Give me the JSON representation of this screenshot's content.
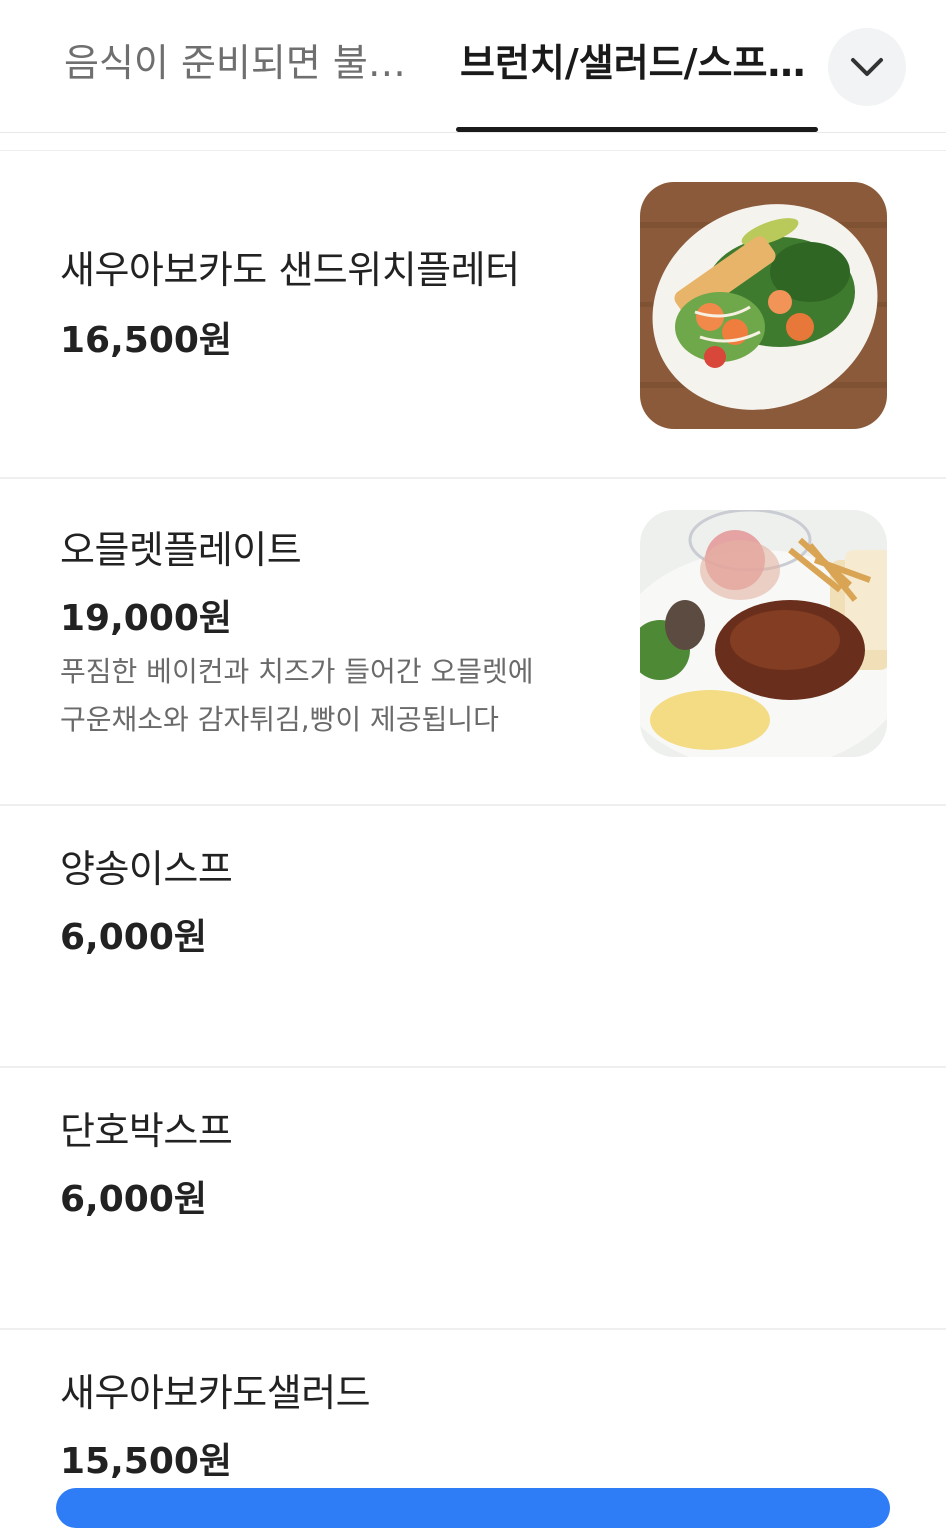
{
  "tabs": [
    {
      "label": "음식이 준비되면 불…",
      "active": false
    },
    {
      "label": "브런치/샐러드/스프…",
      "active": true
    }
  ],
  "dropdown_icon": "chevron-down-icon",
  "items": [
    {
      "name": "새우아보카도 샌드위치플레터",
      "price": "16,500원",
      "description": "",
      "image": "shrimp-avocado-sandwich-plate"
    },
    {
      "name": "오믈렛플레이트",
      "price": "19,000원",
      "description_lines": [
        "푸짐한 베이컨과 치즈가 들어간 오믈렛에",
        "구운채소와 감자튀김,빵이 제공됩니다"
      ],
      "image": "omelet-plate"
    },
    {
      "name": "양송이스프",
      "price": "6,000원"
    },
    {
      "name": "단호박스프",
      "price": "6,000원"
    },
    {
      "name": "새우아보카도샐러드",
      "price": "15,500원"
    }
  ],
  "colors": {
    "accent_blue": "#2e7cf6",
    "text_primary": "#222222",
    "text_secondary": "#6a6a6a",
    "tab_inactive": "#6f6f6f"
  }
}
